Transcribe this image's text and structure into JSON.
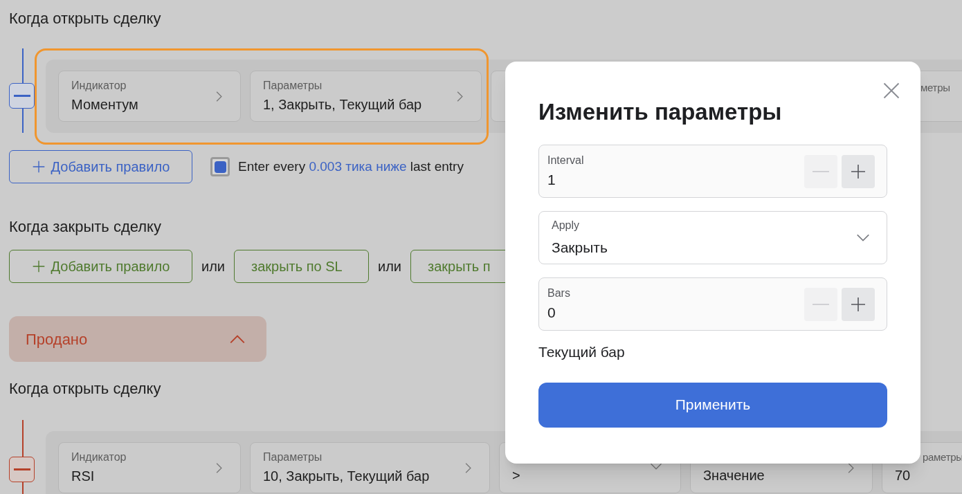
{
  "buy_section": {
    "open_heading": "Когда открыть сделку",
    "rule": {
      "highlighted": true,
      "cards": [
        {
          "label": "Индикатор",
          "value": "Моментум",
          "kind": "link"
        },
        {
          "label": "Параметры",
          "value": "1, Закрыть, Текущий бар",
          "kind": "link"
        },
        {
          "kind": "hidden"
        },
        {
          "label": "метры",
          "kind": "partial"
        }
      ]
    },
    "add_rule": "Добавить правило",
    "entry_option": {
      "checked": true,
      "parts": [
        {
          "kind": "plain",
          "text": "Enter every "
        },
        {
          "kind": "link",
          "text": "0.003 тика ниже"
        },
        {
          "kind": "plain",
          "text": " last entry"
        }
      ]
    },
    "close_heading": "Когда закрыть сделку",
    "close_actions": [
      {
        "kind": "add",
        "text": "Добавить правило"
      },
      {
        "kind": "or",
        "text": "или"
      },
      {
        "kind": "action",
        "text": "закрыть по SL"
      },
      {
        "kind": "or",
        "text": "или"
      },
      {
        "kind": "action",
        "text": "закрыть п"
      }
    ]
  },
  "sold_panel": {
    "title": "Продано",
    "expanded": true
  },
  "sell_section": {
    "open_heading": "Когда открыть сделку",
    "rule": {
      "highlighted": false,
      "cards": [
        {
          "label": "Индикатор",
          "value": "RSI",
          "kind": "link"
        },
        {
          "label": "Параметры",
          "value": "10, Закрыть, Текущий бар",
          "kind": "link"
        },
        {
          "value": ">",
          "kind": "select"
        },
        {
          "value": "Значение",
          "kind": "link"
        },
        {
          "label": "раметры",
          "value": "70",
          "kind": "partial"
        }
      ]
    }
  },
  "dialog": {
    "title": "Изменить параметры",
    "fields": [
      {
        "kind": "stepper",
        "label": "Interval",
        "value": "1",
        "minus_disabled": true,
        "plus_disabled": false
      },
      {
        "kind": "select",
        "label": "Apply",
        "value": "Закрыть"
      },
      {
        "kind": "stepper",
        "label": "Bars",
        "value": "0",
        "minus_disabled": true,
        "plus_disabled": false
      }
    ],
    "note": "Текущий бар",
    "apply": "Применить"
  }
}
